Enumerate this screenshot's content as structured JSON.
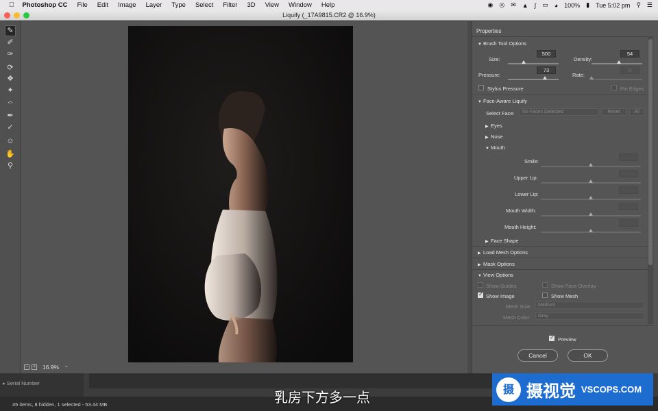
{
  "menubar": {
    "apple_icon": "apple-icon",
    "app_name": "Photoshop CC",
    "items": [
      "File",
      "Edit",
      "Image",
      "Layer",
      "Type",
      "Select",
      "Filter",
      "3D",
      "View",
      "Window",
      "Help"
    ],
    "battery": "100%",
    "clock": "Tue 5:02 pm"
  },
  "window": {
    "title": "Liquify (_17A9815.CR2 @ 16.9%)"
  },
  "zoom": {
    "value": "16.9%"
  },
  "panel": {
    "title": "Properties",
    "brush": {
      "header": "Brush Tool Options",
      "size_label": "Size:",
      "size_value": "500",
      "density_label": "Density:",
      "density_value": "54",
      "pressure_label": "Pressure:",
      "pressure_value": "73",
      "rate_label": "Rate:",
      "rate_value": "0",
      "stylus_label": "Stylus Pressure",
      "pin_label": "Pin Edges"
    },
    "face": {
      "header": "Face-Aware Liquify",
      "select_label": "Select Face:",
      "select_value": "No Faces Detected",
      "reset_label": "Reset",
      "all_label": "All",
      "eyes": "Eyes",
      "nose": "Nose",
      "mouth": "Mouth",
      "smile": "Smile:",
      "upper_lip": "Upper Lip:",
      "lower_lip": "Lower Lip:",
      "mouth_width": "Mouth Width:",
      "mouth_height": "Mouth Height:",
      "face_shape": "Face Shape"
    },
    "load_mesh": "Load Mesh Options",
    "mask": "Mask Options",
    "view": {
      "header": "View Options",
      "show_guides": "Show Guides",
      "show_face_overlay": "Show Face Overlay",
      "show_image": "Show Image",
      "show_mesh": "Show Mesh",
      "mesh_size_label": "Mesh Size:",
      "mesh_size_value": "Medium",
      "mesh_color_label": "Mesh Color:",
      "mesh_color_value": "Gray"
    },
    "preview_label": "Preview",
    "cancel_label": "Cancel",
    "ok_label": "OK"
  },
  "background_app": {
    "serial_label": "Serial Number",
    "status": "45 items, 8 hidden, 1 selected - 53.44 MB"
  },
  "subtitle": "乳房下方多一点",
  "watermark": {
    "brand": "摄视觉",
    "site": "VSCOPS.COM"
  }
}
